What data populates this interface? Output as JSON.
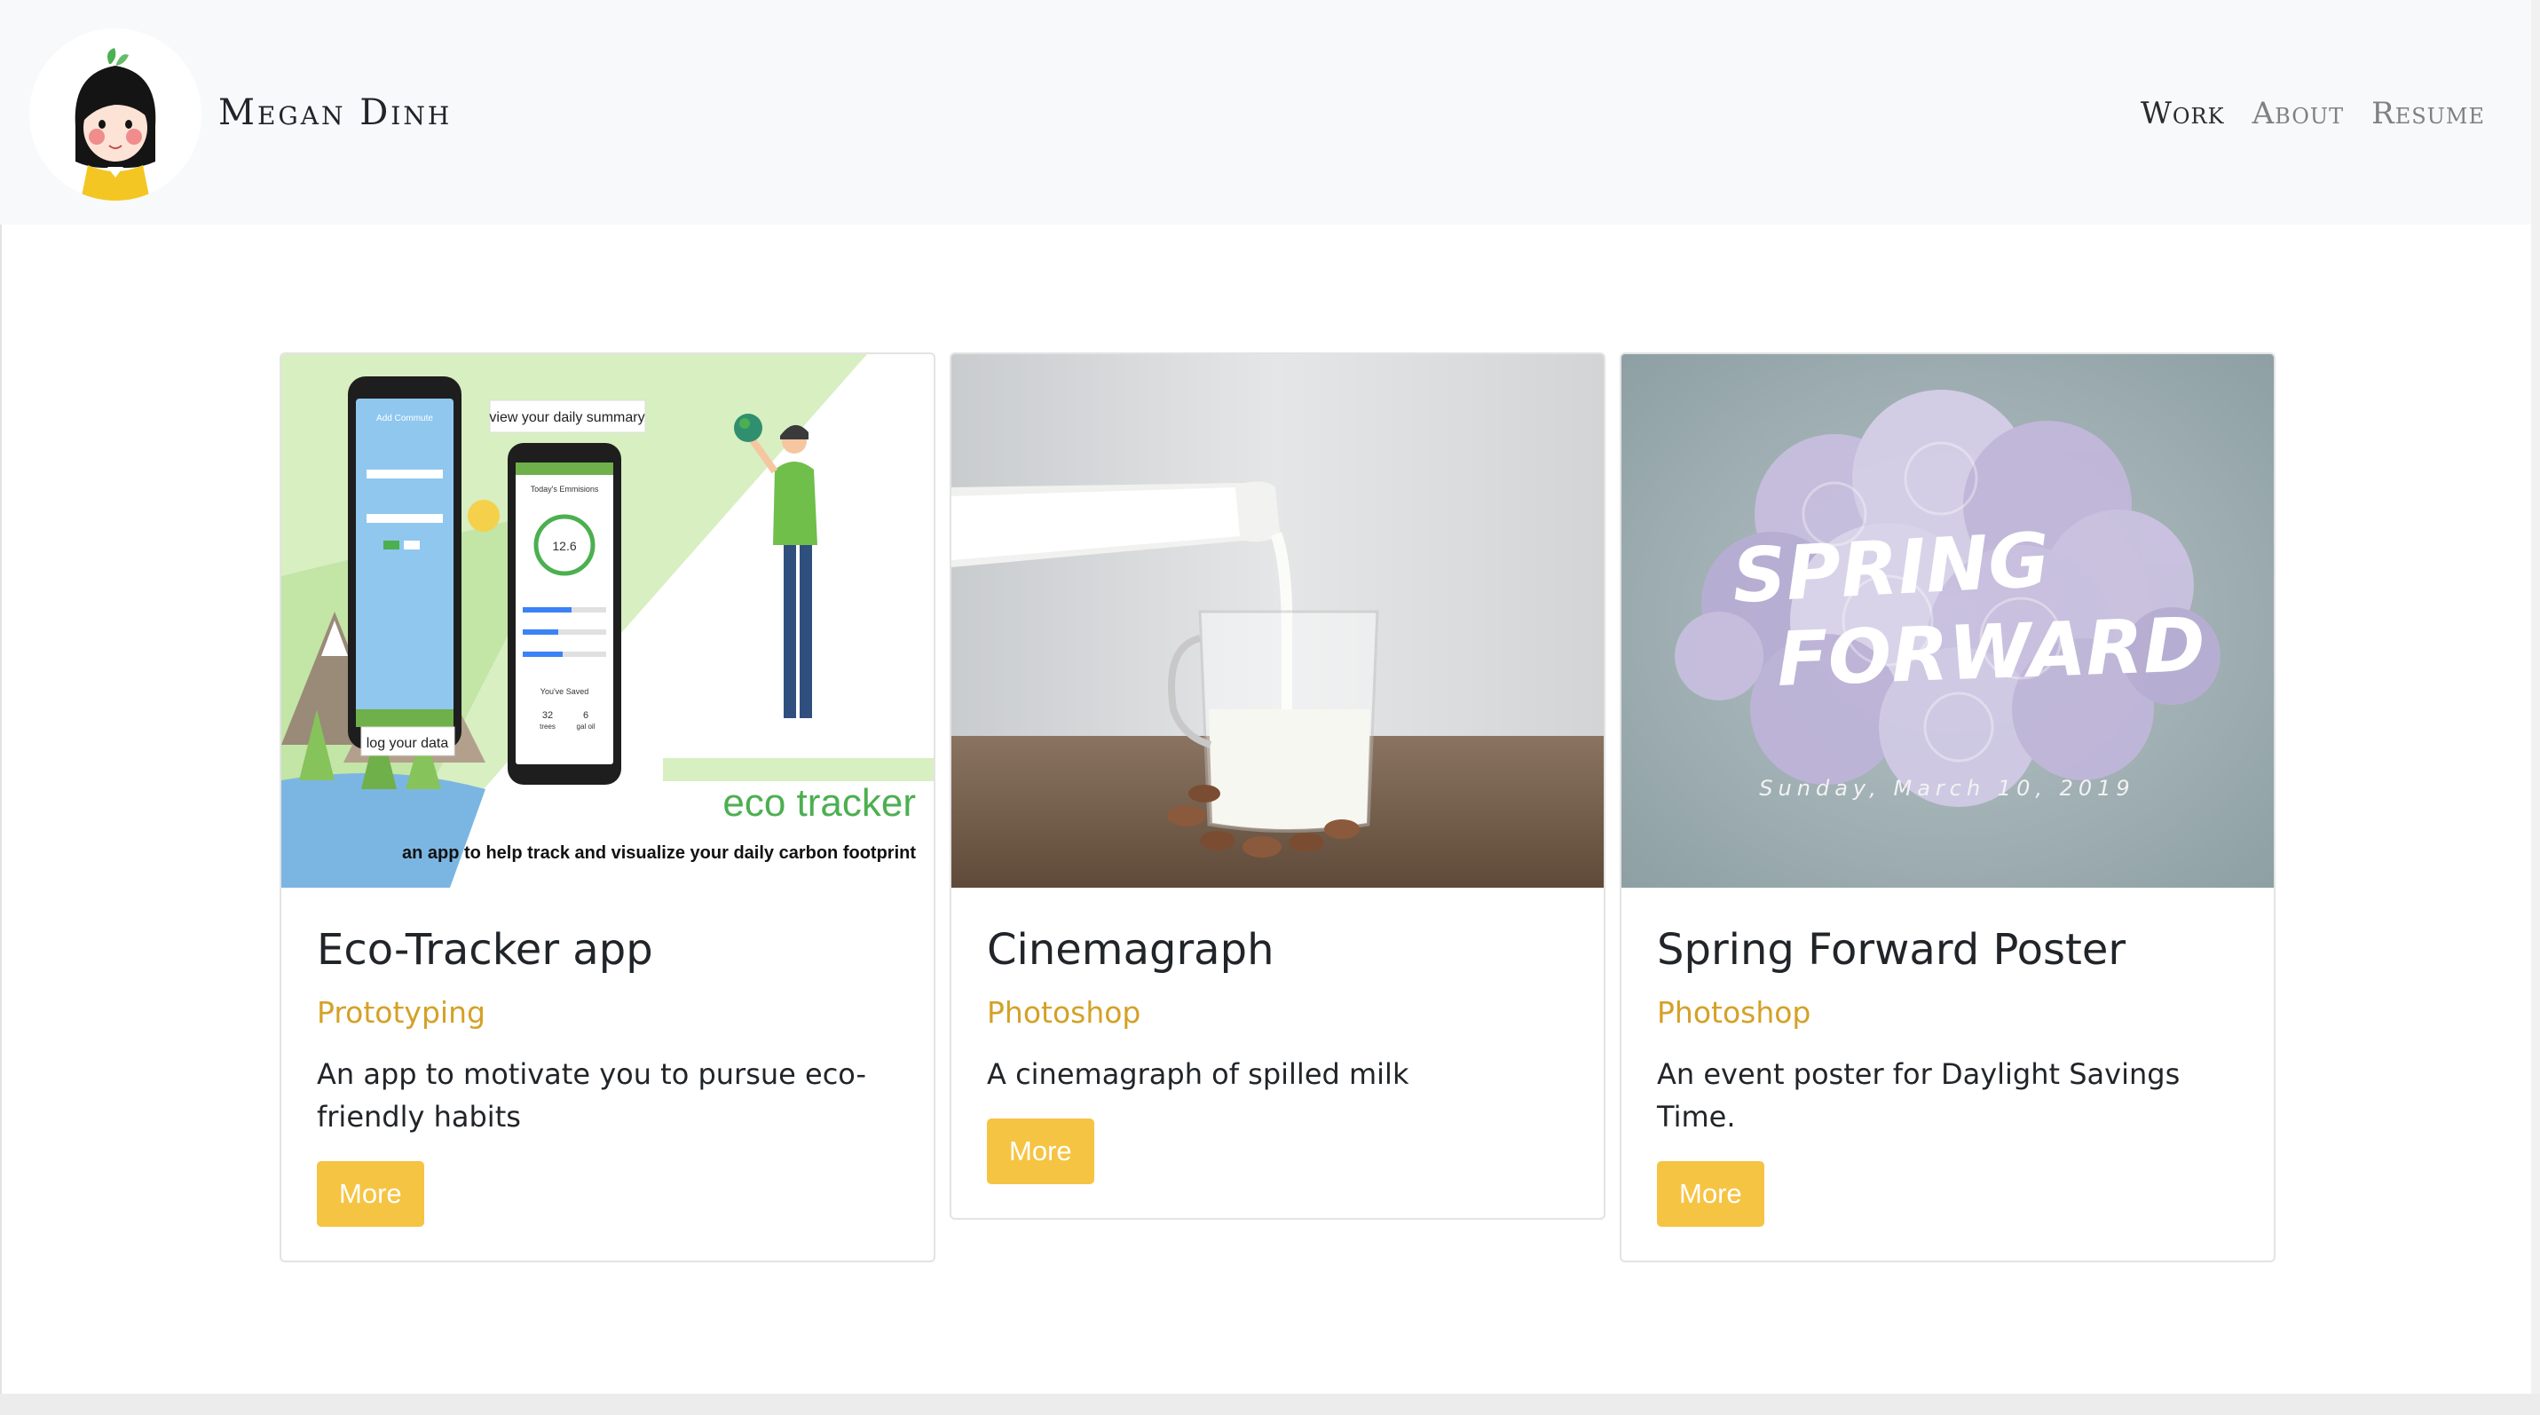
{
  "navbar": {
    "brand": "Megan Dinh",
    "links": [
      {
        "label": "Work",
        "active": true
      },
      {
        "label": "About",
        "active": false
      },
      {
        "label": "Resume",
        "active": false
      }
    ]
  },
  "cards": [
    {
      "title": "Eco-Tracker app",
      "category": "Prototyping",
      "description": "An app to motivate you to pursue eco-friendly habits",
      "button": "More",
      "image": {
        "headline": "eco tracker",
        "tagline": "an app to help track and visualize your daily carbon footprint",
        "callout_summary": "view your daily summary",
        "callout_log": "log your data",
        "screen_header": "Add Commute",
        "emissions_label": "Today's Emmisions",
        "emissions_value": "12.6",
        "saved_label": "You've Saved",
        "trees_value": "32",
        "trees_label": "trees",
        "gas_value": "6",
        "gas_label": "gal oil"
      }
    },
    {
      "title": "Cinemagraph",
      "category": "Photoshop",
      "description": "A cinemagraph of spilled milk",
      "button": "More"
    },
    {
      "title": "Spring Forward Poster",
      "category": "Photoshop",
      "description": "An event poster for Daylight Savings Time.",
      "button": "More",
      "image": {
        "line1": "SPRING",
        "line2": "FORWARD",
        "date": "Sunday, March 10, 2019"
      }
    }
  ],
  "colors": {
    "accent": "#f6c443",
    "category": "#d4a127",
    "navbar_bg": "#f8f9fa"
  }
}
